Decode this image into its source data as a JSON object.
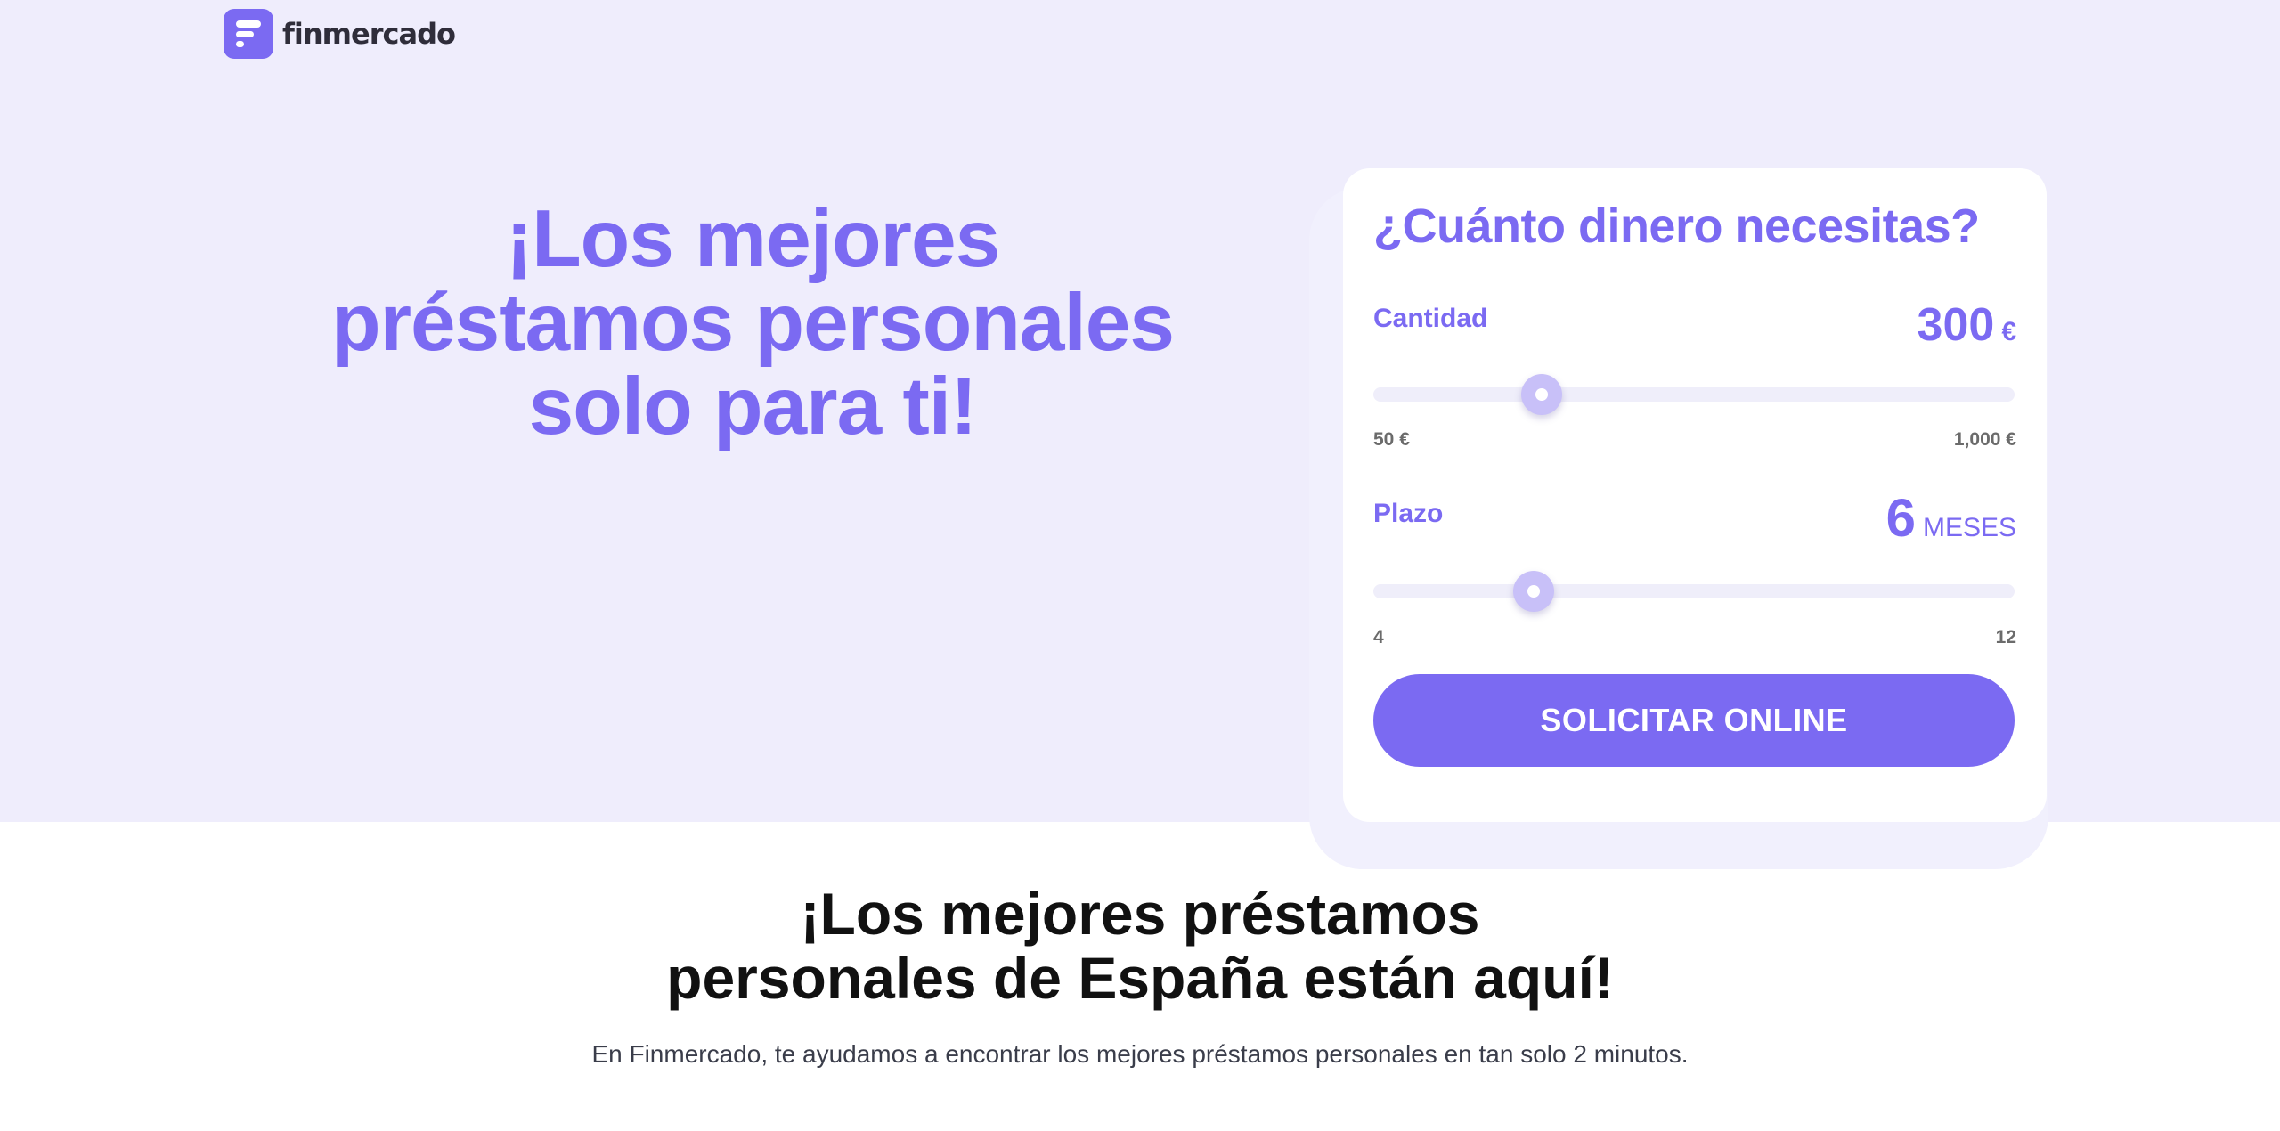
{
  "brand": {
    "name": "finmercado",
    "logo_icon": "finmercado-logo-icon",
    "accent": "#7b6af2",
    "hero_bg": "#efedfc"
  },
  "hero": {
    "title_lines": [
      "¡Los mejores",
      "préstamos personales",
      "solo para ti!"
    ]
  },
  "calculator": {
    "title": "¿Cuánto dinero necesitas?",
    "amount": {
      "label": "Cantidad",
      "value": "300",
      "unit": "€",
      "min_label": "50 €",
      "max_label": "1,000 €",
      "min": 50,
      "max": 1000,
      "current": 300
    },
    "term": {
      "label": "Plazo",
      "value": "6",
      "unit": "MESES",
      "min_label": "4",
      "max_label": "12",
      "min": 4,
      "max": 12,
      "current": 6
    },
    "cta_label": "SOLICITAR ONLINE"
  },
  "section": {
    "title_lines": [
      "¡Los mejores préstamos",
      "personales de España están aquí!"
    ],
    "text": "En Finmercado, te ayudamos a encontrar los mejores préstamos personales en tan solo 2 minutos."
  }
}
